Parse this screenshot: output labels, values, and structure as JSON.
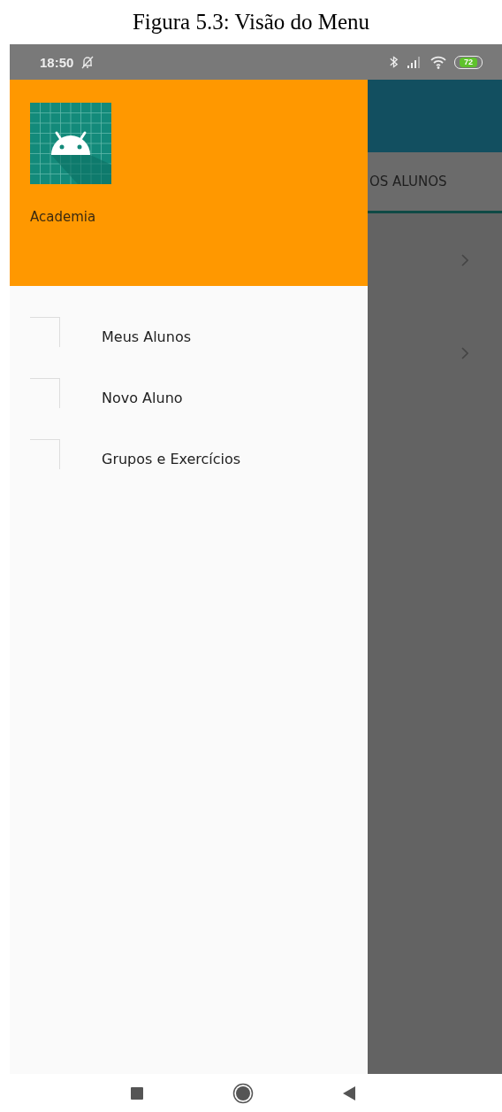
{
  "caption": "Figura 5.3: Visão do Menu",
  "status_bar": {
    "time": "18:50",
    "battery": "72"
  },
  "drawer": {
    "header": {
      "title": "Academia"
    },
    "items": [
      {
        "label": "Meus Alunos"
      },
      {
        "label": "Novo Aluno"
      },
      {
        "label": "Grupos e Exercícios"
      }
    ]
  },
  "background_screen": {
    "tab_label": "OS ALUNOS",
    "rows": [
      {
        "kind": "chevron"
      },
      {
        "kind": "chevron"
      }
    ]
  }
}
